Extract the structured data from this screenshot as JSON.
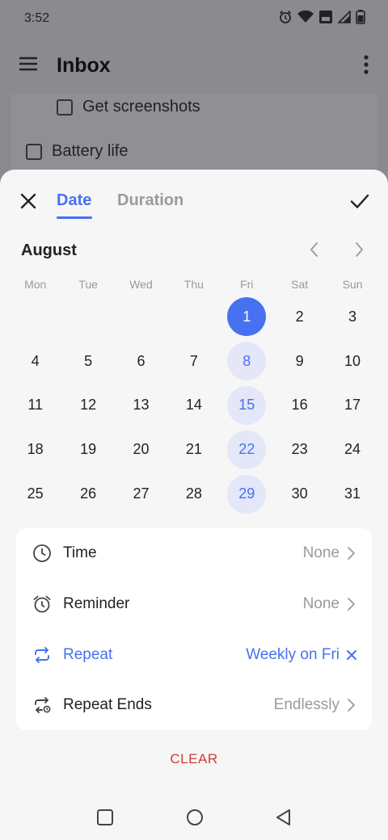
{
  "status_bar": {
    "time": "3:52",
    "icons": [
      "alarm-icon",
      "wifi-icon",
      "volte-icon",
      "signal-icon",
      "battery-icon"
    ]
  },
  "app_bar": {
    "title": "Inbox"
  },
  "background_tasks": [
    {
      "title": "Get screenshots"
    },
    {
      "title": "Battery life"
    }
  ],
  "sheet": {
    "tabs": [
      {
        "label": "Date",
        "active": true
      },
      {
        "label": "Duration",
        "active": false
      }
    ],
    "calendar": {
      "month": "August",
      "weekdays": [
        "Mon",
        "Tue",
        "Wed",
        "Thu",
        "Fri",
        "Sat",
        "Sun"
      ],
      "leading_blanks": 4,
      "days": [
        "1",
        "2",
        "3",
        "4",
        "5",
        "6",
        "7",
        "8",
        "9",
        "10",
        "11",
        "12",
        "13",
        "14",
        "15",
        "16",
        "17",
        "18",
        "19",
        "20",
        "21",
        "22",
        "23",
        "24",
        "25",
        "26",
        "27",
        "28",
        "29",
        "30",
        "31"
      ],
      "selected_day": "1",
      "recurring_days": [
        "8",
        "15",
        "22",
        "29"
      ]
    },
    "options": {
      "time": {
        "label": "Time",
        "value": "None"
      },
      "reminder": {
        "label": "Reminder",
        "value": "None"
      },
      "repeat": {
        "label": "Repeat",
        "value": "Weekly on Fri"
      },
      "repeat_ends": {
        "label": "Repeat Ends",
        "value": "Endlessly"
      }
    },
    "clear_label": "CLEAR"
  },
  "colors": {
    "accent": "#4771f0",
    "accent_light": "#e3e7f8",
    "clear": "#d33a2f",
    "muted": "#9a9a9e"
  }
}
